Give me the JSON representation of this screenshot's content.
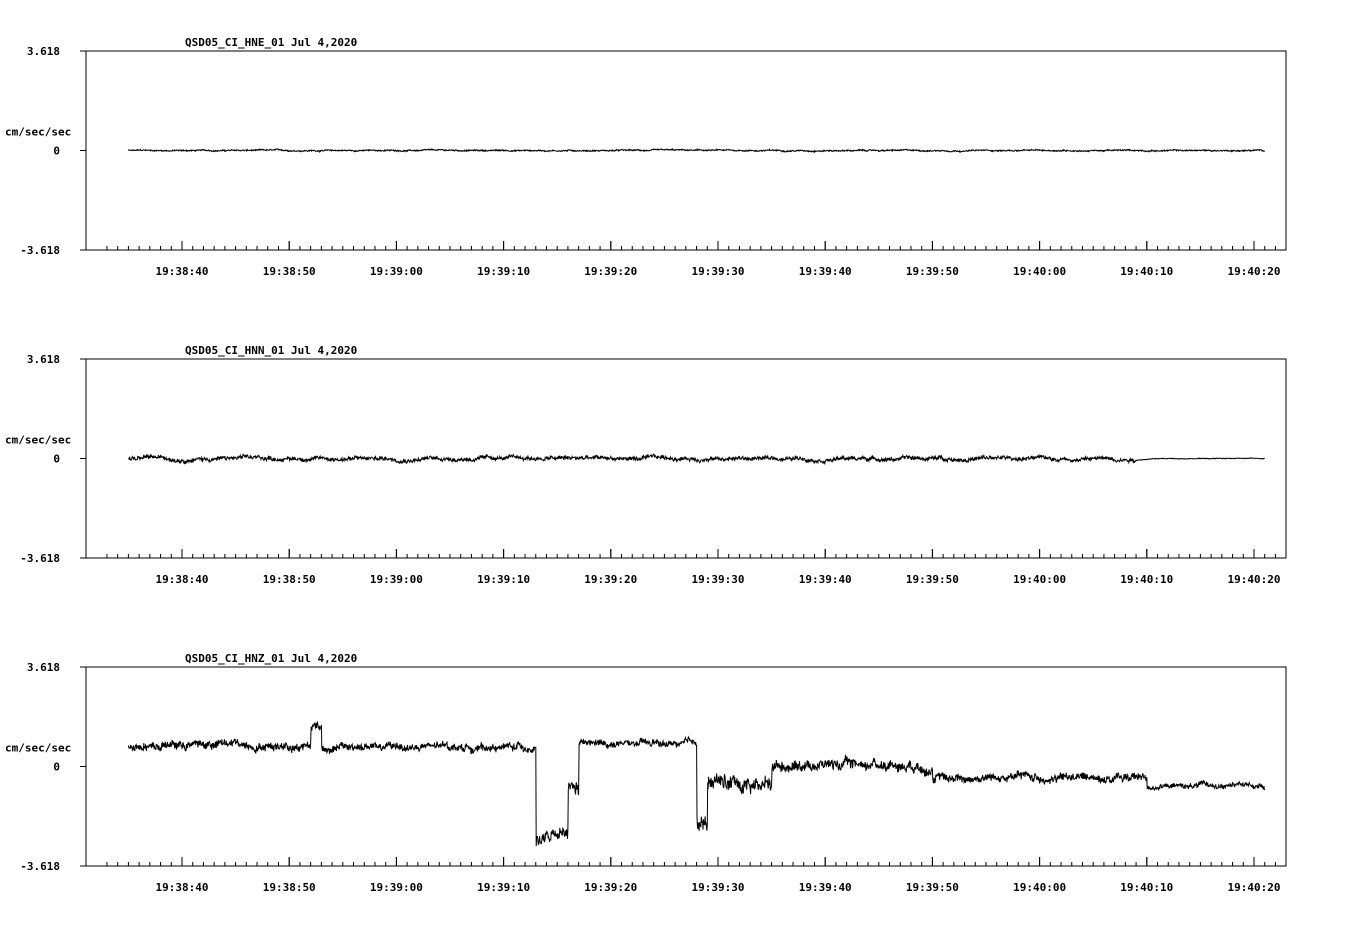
{
  "chart_data": [
    {
      "type": "line",
      "title": "QSD05_CI_HNE_01  Jul 4,2020",
      "ylabel": "cm/sec/sec",
      "ytick_labels": [
        "3.618",
        "0",
        "-3.618"
      ],
      "ylim": [
        -3.618,
        3.618
      ],
      "xlim_seconds_of_minute_start": "19:38:33",
      "xtick_labels": [
        "19:38:40",
        "19:38:50",
        "19:39:00",
        "19:39:10",
        "19:39:20",
        "19:39:30",
        "19:39:40",
        "19:39:50",
        "19:40:00",
        "19:40:10",
        "19:40:20"
      ],
      "x": [
        "19:38:35",
        "19:40:21"
      ],
      "noise_amplitude": 0.04,
      "segments": [
        {
          "from": "19:38:35",
          "to": "19:40:21",
          "level": 0.0,
          "noise": 0.04
        }
      ]
    },
    {
      "type": "line",
      "title": "QSD05_CI_HNN_01  Jul 4,2020",
      "ylabel": "cm/sec/sec",
      "ytick_labels": [
        "3.618",
        "0",
        "-3.618"
      ],
      "ylim": [
        -3.618,
        3.618
      ],
      "xtick_labels": [
        "19:38:40",
        "19:38:50",
        "19:39:00",
        "19:39:10",
        "19:39:20",
        "19:39:30",
        "19:39:40",
        "19:39:50",
        "19:40:00",
        "19:40:10",
        "19:40:20"
      ],
      "x": [
        "19:38:35",
        "19:40:21"
      ],
      "segments": [
        {
          "from": "19:38:35",
          "to": "19:40:09",
          "level": 0.0,
          "noise": 0.12
        },
        {
          "from": "19:40:09",
          "to": "19:40:21",
          "level": 0.0,
          "noise": 0.02
        }
      ]
    },
    {
      "type": "line",
      "title": "QSD05_CI_HNZ_01  Jul 4,2020",
      "ylabel": "cm/sec/sec",
      "ytick_labels": [
        "3.618",
        "0",
        "-3.618"
      ],
      "ylim": [
        -3.618,
        3.618
      ],
      "xtick_labels": [
        "19:38:40",
        "19:38:50",
        "19:39:00",
        "19:39:10",
        "19:39:20",
        "19:39:30",
        "19:39:40",
        "19:39:50",
        "19:40:00",
        "19:40:10",
        "19:40:20"
      ],
      "x": [
        "19:38:35",
        "19:40:21"
      ],
      "segments": [
        {
          "from": "19:38:35",
          "to": "19:38:52",
          "level": 0.8,
          "noise": 0.25
        },
        {
          "from": "19:38:52",
          "to": "19:38:53",
          "level": 1.5,
          "noise": 0.25
        },
        {
          "from": "19:38:53",
          "to": "19:39:13",
          "level": 0.7,
          "noise": 0.22
        },
        {
          "from": "19:39:13",
          "to": "19:39:16",
          "level": -2.6,
          "noise": 0.35
        },
        {
          "from": "19:39:16",
          "to": "19:39:17",
          "level": -0.9,
          "noise": 0.4
        },
        {
          "from": "19:39:17",
          "to": "19:39:28",
          "level": 0.8,
          "noise": 0.2
        },
        {
          "from": "19:39:28",
          "to": "19:39:29",
          "level": -2.0,
          "noise": 0.5
        },
        {
          "from": "19:39:29",
          "to": "19:39:35",
          "level": -0.6,
          "noise": 0.45
        },
        {
          "from": "19:39:35",
          "to": "19:39:50",
          "level": 0.1,
          "noise": 0.3
        },
        {
          "from": "19:39:50",
          "to": "19:40:10",
          "level": -0.4,
          "noise": 0.25
        },
        {
          "from": "19:40:10",
          "to": "19:40:21",
          "level": -0.7,
          "noise": 0.15
        }
      ]
    }
  ]
}
